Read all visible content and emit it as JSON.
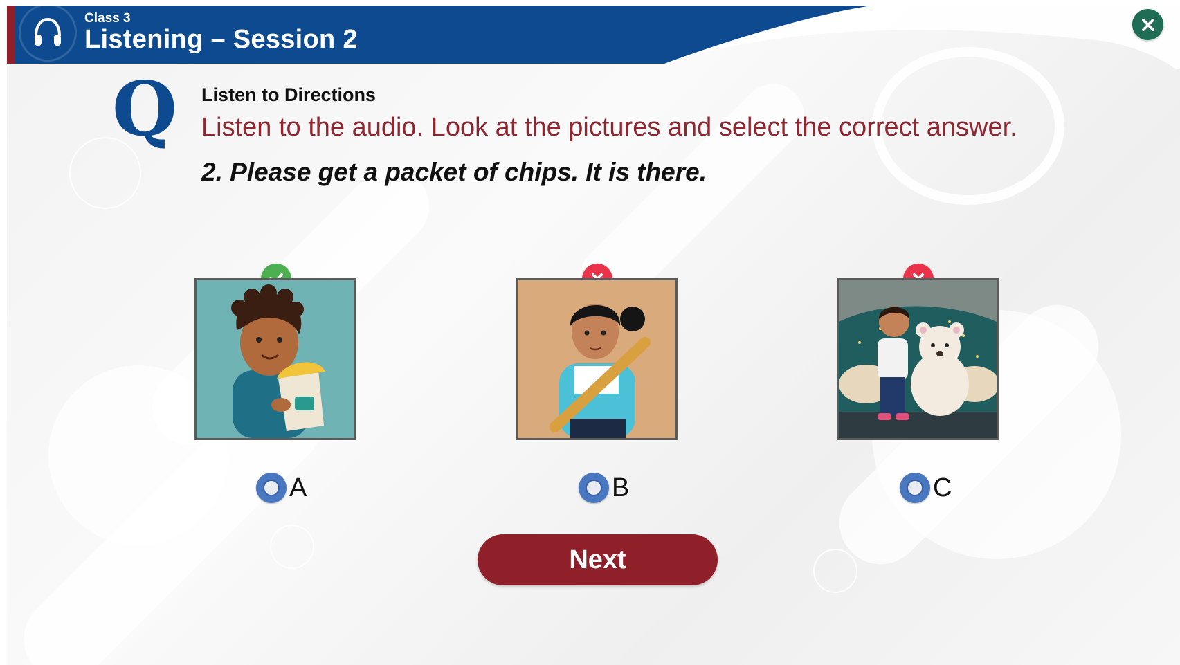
{
  "header": {
    "class_label": "Class 3",
    "session_title": "Listening – Session 2",
    "icon": "headphones-icon",
    "close_icon": "close-icon",
    "brand_color": "#0d4a8f"
  },
  "question": {
    "letter": "Q",
    "heading": "Listen to Directions",
    "instruction": "Listen to the audio. Look at the pictures and select the correct answer.",
    "text": "2. Please get a packet of chips. It is there."
  },
  "options": [
    {
      "label": "A",
      "picture": "boy holding a packet of chips",
      "status": "correct",
      "status_icon": "check-icon",
      "status_color": "#4caf50"
    },
    {
      "label": "B",
      "picture": "girl holding a baseball bat",
      "status": "wrong",
      "status_icon": "cross-icon",
      "status_color": "#e8334a"
    },
    {
      "label": "C",
      "picture": "boy with a teddy bear",
      "status": "wrong",
      "status_icon": "cross-icon",
      "status_color": "#e8334a"
    }
  ],
  "next_button": {
    "label": "Next",
    "color": "#8f1f28"
  }
}
